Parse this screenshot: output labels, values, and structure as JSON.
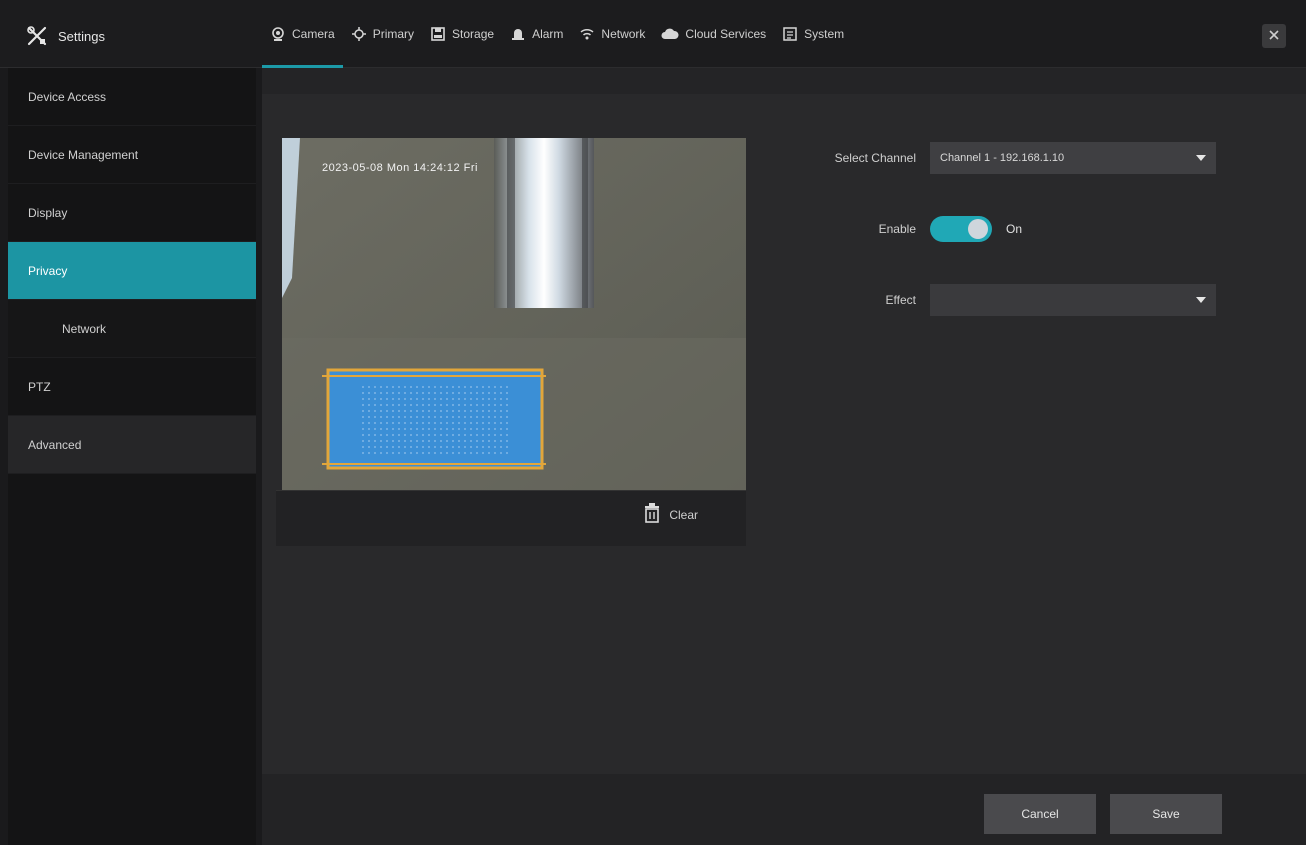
{
  "app": {
    "title": "Settings"
  },
  "tabs": [
    {
      "label": "Camera",
      "icon": "camera-icon",
      "active": true
    },
    {
      "label": "Primary",
      "icon": "crosshair-icon",
      "active": false
    },
    {
      "label": "Storage",
      "icon": "storage-icon",
      "active": false
    },
    {
      "label": "Alarm",
      "icon": "alarm-icon",
      "active": false
    },
    {
      "label": "Network",
      "icon": "network-icon",
      "active": false
    },
    {
      "label": "Cloud Services",
      "icon": "cloud-icon",
      "active": false
    },
    {
      "label": "System",
      "icon": "system-icon",
      "active": false
    }
  ],
  "sidebar": {
    "items": [
      {
        "label": "Device Access"
      },
      {
        "label": "Device Management"
      },
      {
        "label": "Display"
      },
      {
        "label": "Privacy"
      },
      {
        "label": "Network"
      },
      {
        "label": "PTZ"
      },
      {
        "label": "Advanced"
      }
    ]
  },
  "preview": {
    "osd_text": "2023-05-08 Mon 14:24:12 Fri",
    "clear_label": "Clear"
  },
  "form": {
    "channel_label": "Select Channel",
    "channel_value": "Channel 1 - 192.168.1.10",
    "enable_label": "Enable",
    "enable_state": "On",
    "effect_label": "Effect",
    "effect_value": ""
  },
  "footer": {
    "cancel_label": "Cancel",
    "save_label": "Save"
  },
  "colors": {
    "accent": "#1c9aa8",
    "mask": "#3b8fd6",
    "mask_border": "#e2a63a"
  }
}
